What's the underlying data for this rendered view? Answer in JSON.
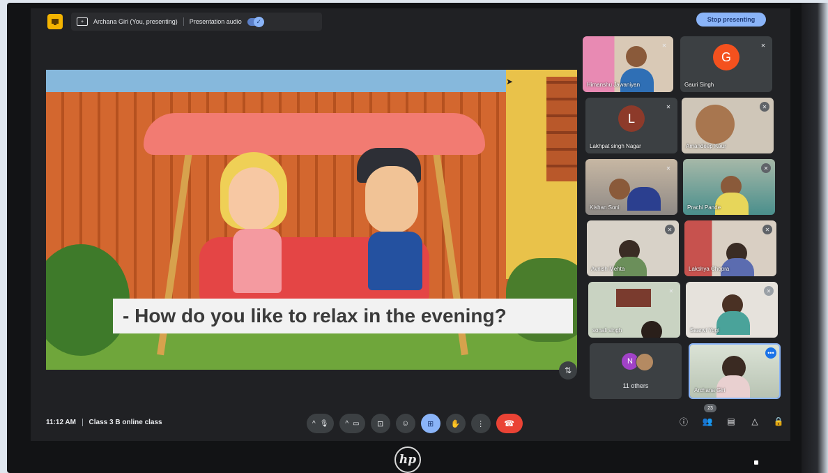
{
  "topbar": {
    "presenter_label": "Archana Giri (You, presenting)",
    "audio_label": "Presentation audio",
    "stop_button": "Stop presenting"
  },
  "slide": {
    "caption": "- How do you like to relax in the evening?"
  },
  "participants": [
    {
      "name": "Himanshu Jawaniyan",
      "type": "video"
    },
    {
      "name": "Gauri Singh",
      "type": "avatar",
      "initial": "G",
      "color": "#f4511e"
    },
    {
      "name": "Lakhpat singh Nagar",
      "type": "avatar",
      "initial": "L",
      "color": "#8d3a2a"
    },
    {
      "name": "Amandeep Kaur",
      "type": "video"
    },
    {
      "name": "Kishan Soni",
      "type": "video"
    },
    {
      "name": "Prachi Pande",
      "type": "video"
    },
    {
      "name": "Avnish Mehta",
      "type": "video"
    },
    {
      "name": "Lakshya Chopra",
      "type": "video"
    },
    {
      "name": "sonali singh",
      "type": "video"
    },
    {
      "name": "Saanvi Yogi",
      "type": "video"
    }
  ],
  "others": {
    "initial": "N",
    "label": "11 others"
  },
  "self_tile": {
    "name": "Archana Giri",
    "more_icon": "more-horiz-icon"
  },
  "bottom": {
    "time": "11:12 AM",
    "meeting_name": "Class 3 B online class",
    "people_count": "23"
  },
  "colors": {
    "accent": "#8ab4f8",
    "end_call": "#ea4335",
    "screen_bg": "#202124",
    "present_icon": "#f4b400"
  }
}
